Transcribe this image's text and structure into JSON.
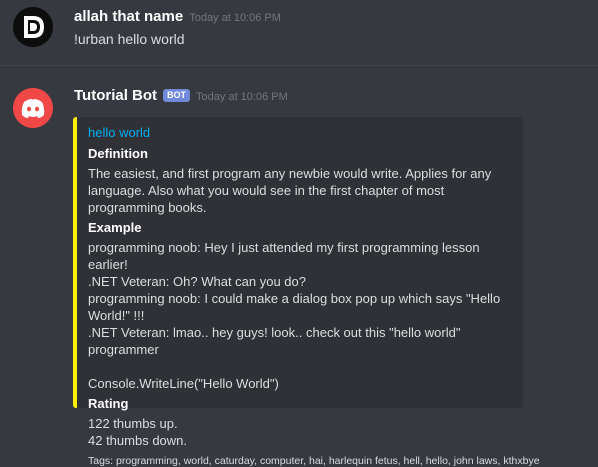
{
  "messages": [
    {
      "username": "allah that name",
      "timestamp": "Today at 10:06 PM",
      "content": "!urban hello world"
    },
    {
      "username": "Tutorial Bot",
      "badge": "BOT",
      "timestamp": "Today at 10:06 PM",
      "embed": {
        "title": "hello world",
        "accent_color": "#fff000",
        "fields": [
          {
            "name": "Definition",
            "value": "The easiest, and first program any newbie would write. Applies for any language. Also what you would see in the first chapter of most programming books."
          },
          {
            "name": "Example",
            "value": "programming noob: Hey I just attended my first programming lesson earlier!\n.NET Veteran: Oh? What can you do?\nprogramming noob: I could make a dialog box pop up which says \"Hello World!\" !!!\n.NET Veteran: lmao.. hey guys! look.. check out this \"hello world\" programmer\n\nConsole.WriteLine(\"Hello World\")"
          },
          {
            "name": "Rating",
            "value": "122 thumbs up.\n42 thumbs down."
          }
        ],
        "footer": "Tags: programming, world, caturday, computer, hai, harlequin fetus, hell, hello, john laws, kthxbye"
      }
    }
  ],
  "icons": {
    "user_avatar": "stylized-d-logo-icon",
    "bot_avatar": "discord-logo-icon"
  }
}
